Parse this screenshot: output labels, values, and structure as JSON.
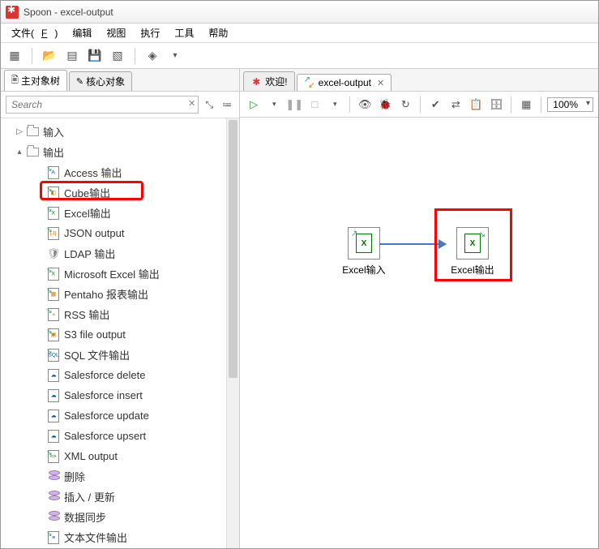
{
  "title": "Spoon - excel-output",
  "menu": {
    "file": "文件(F)",
    "edit": "编辑",
    "view": "视图",
    "run": "执行",
    "tools": "工具",
    "help": "帮助"
  },
  "sidebar": {
    "tabs": {
      "main": "主对象树",
      "core": "核心对象"
    },
    "search_placeholder": "Search",
    "tree": {
      "input": "输入",
      "output": "输出",
      "items": [
        "Access 输出",
        "Cube输出",
        "Excel输出",
        "JSON output",
        "LDAP 输出",
        "Microsoft Excel 输出",
        "Pentaho 报表输出",
        "RSS 输出",
        "S3 file output",
        "SQL 文件输出",
        "Salesforce delete",
        "Salesforce insert",
        "Salesforce update",
        "Salesforce upsert",
        "XML output",
        "删除",
        "插入 / 更新",
        "数据同步",
        "文本文件输出"
      ]
    }
  },
  "content": {
    "tabs": {
      "welcome": "欢迎!",
      "active": "excel-output"
    },
    "zoom": "100%",
    "nodes": {
      "input": "Excel输入",
      "output": "Excel输出"
    }
  }
}
